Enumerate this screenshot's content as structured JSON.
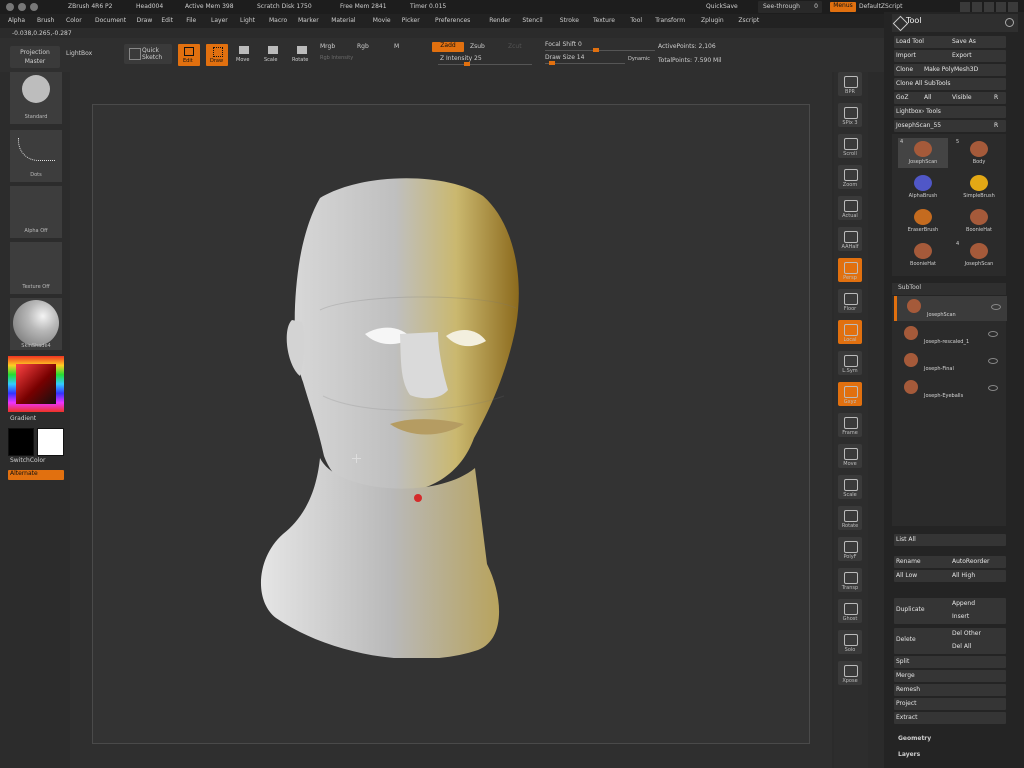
{
  "title_bar": {
    "app": "ZBrush 4R6 P2",
    "file": "Head004",
    "active_mem": "Active Mem 398",
    "scratch_disk": "Scratch Disk 1750",
    "free_mem": "Free Mem 2841",
    "timer": "Timer 0.015",
    "quick_save": "QuickSave",
    "see_through": "See-through",
    "see_through_value": "0",
    "menus": "Menus",
    "default_script": "DefaultZScript"
  },
  "menu_items": [
    "Alpha",
    "Brush",
    "Color",
    "Document",
    "Draw",
    "Edit",
    "File",
    "Layer",
    "Light",
    "Macro",
    "Marker",
    "Material",
    "Movie",
    "Picker",
    "Preferences",
    "Render",
    "Stencil",
    "Stroke",
    "Texture",
    "Tool",
    "Transform",
    "Zplugin",
    "Zscript"
  ],
  "coords": "-0.038,0.265,-0.287",
  "toolbar": {
    "projection_master": "Projection Master",
    "lightbox": "LightBox",
    "quick_sketch": "Quick Sketch",
    "edit": "Edit",
    "draw": "Draw",
    "move": "Move",
    "scale": "Scale",
    "rotate": "Rotate",
    "mrgb": "Mrgb",
    "rgb": "Rgb",
    "m": "M",
    "rgb_intensity": "Rgb Intensity",
    "zadd": "Zadd",
    "zsub": "Zsub",
    "zcut": "Zcut",
    "z_intensity": "Z Intensity 25",
    "focal_shift": "Focal Shift 0",
    "draw_size": "Draw Size 14",
    "dynamic": "Dynamic",
    "active_points": "ActivePoints: 2,106",
    "total_points": "TotalPoints: 7.590 Mil"
  },
  "left_shelf": {
    "brush_label": "Standard",
    "stroke_label": "Dots",
    "alpha_label": "Alpha Off",
    "texture_label": "Texture Off",
    "material_label": "SkinShade4",
    "gradient": "Gradient",
    "switch_color": "SwitchColor",
    "alternate": "Alternate"
  },
  "right_shelf": [
    "BPR",
    "SPix 3",
    "Scroll",
    "Zoom",
    "Actual",
    "AAHalf",
    "Persp",
    "Floor",
    "Local",
    "L.Sym",
    "Gxyz",
    "Frame",
    "Move",
    "Scale",
    "Rotate",
    "PolyF",
    "Transp",
    "Ghost",
    "Solo",
    "Xpose"
  ],
  "tool_panel": {
    "title": "Tool",
    "load_tool": "Load Tool",
    "save_as": "Save As",
    "import": "Import",
    "export": "Export",
    "clone": "Clone",
    "make_polymesh": "Make PolyMesh3D",
    "clone_all": "Clone All SubTools",
    "goz": "GoZ",
    "all": "All",
    "visible": "Visible",
    "r": "R",
    "lightbox_tools": "Lightbox› Tools",
    "current_tool": "JosephScan_55",
    "tools": [
      {
        "name": "JosephScan",
        "count": "4"
      },
      {
        "name": "Body",
        "count": "5"
      },
      {
        "name": "AlphaBrush",
        "count": ""
      },
      {
        "name": "SimpleBrush",
        "count": ""
      },
      {
        "name": "EraserBrush",
        "count": ""
      },
      {
        "name": "BoonieHat",
        "count": ""
      },
      {
        "name": "BoonieHat",
        "count": ""
      },
      {
        "name": "JosephScan",
        "count": "4"
      }
    ],
    "subtool_title": "SubTool",
    "subtools": [
      "JosephScan",
      "Joseph-rescaled_1",
      "Joseph-Final",
      "Joseph-Eyeballs"
    ],
    "list_all": "List All",
    "rename": "Rename",
    "autoreorder": "AutoReorder",
    "all_low": "All Low",
    "all_high": "All High",
    "duplicate": "Duplicate",
    "append": "Append",
    "insert": "Insert",
    "delete": "Delete",
    "del_other": "Del Other",
    "del_all": "Del All",
    "split": "Split",
    "merge": "Merge",
    "remesh": "Remesh",
    "project": "Project",
    "extract": "Extract",
    "geometry": "Geometry",
    "layers": "Layers"
  }
}
